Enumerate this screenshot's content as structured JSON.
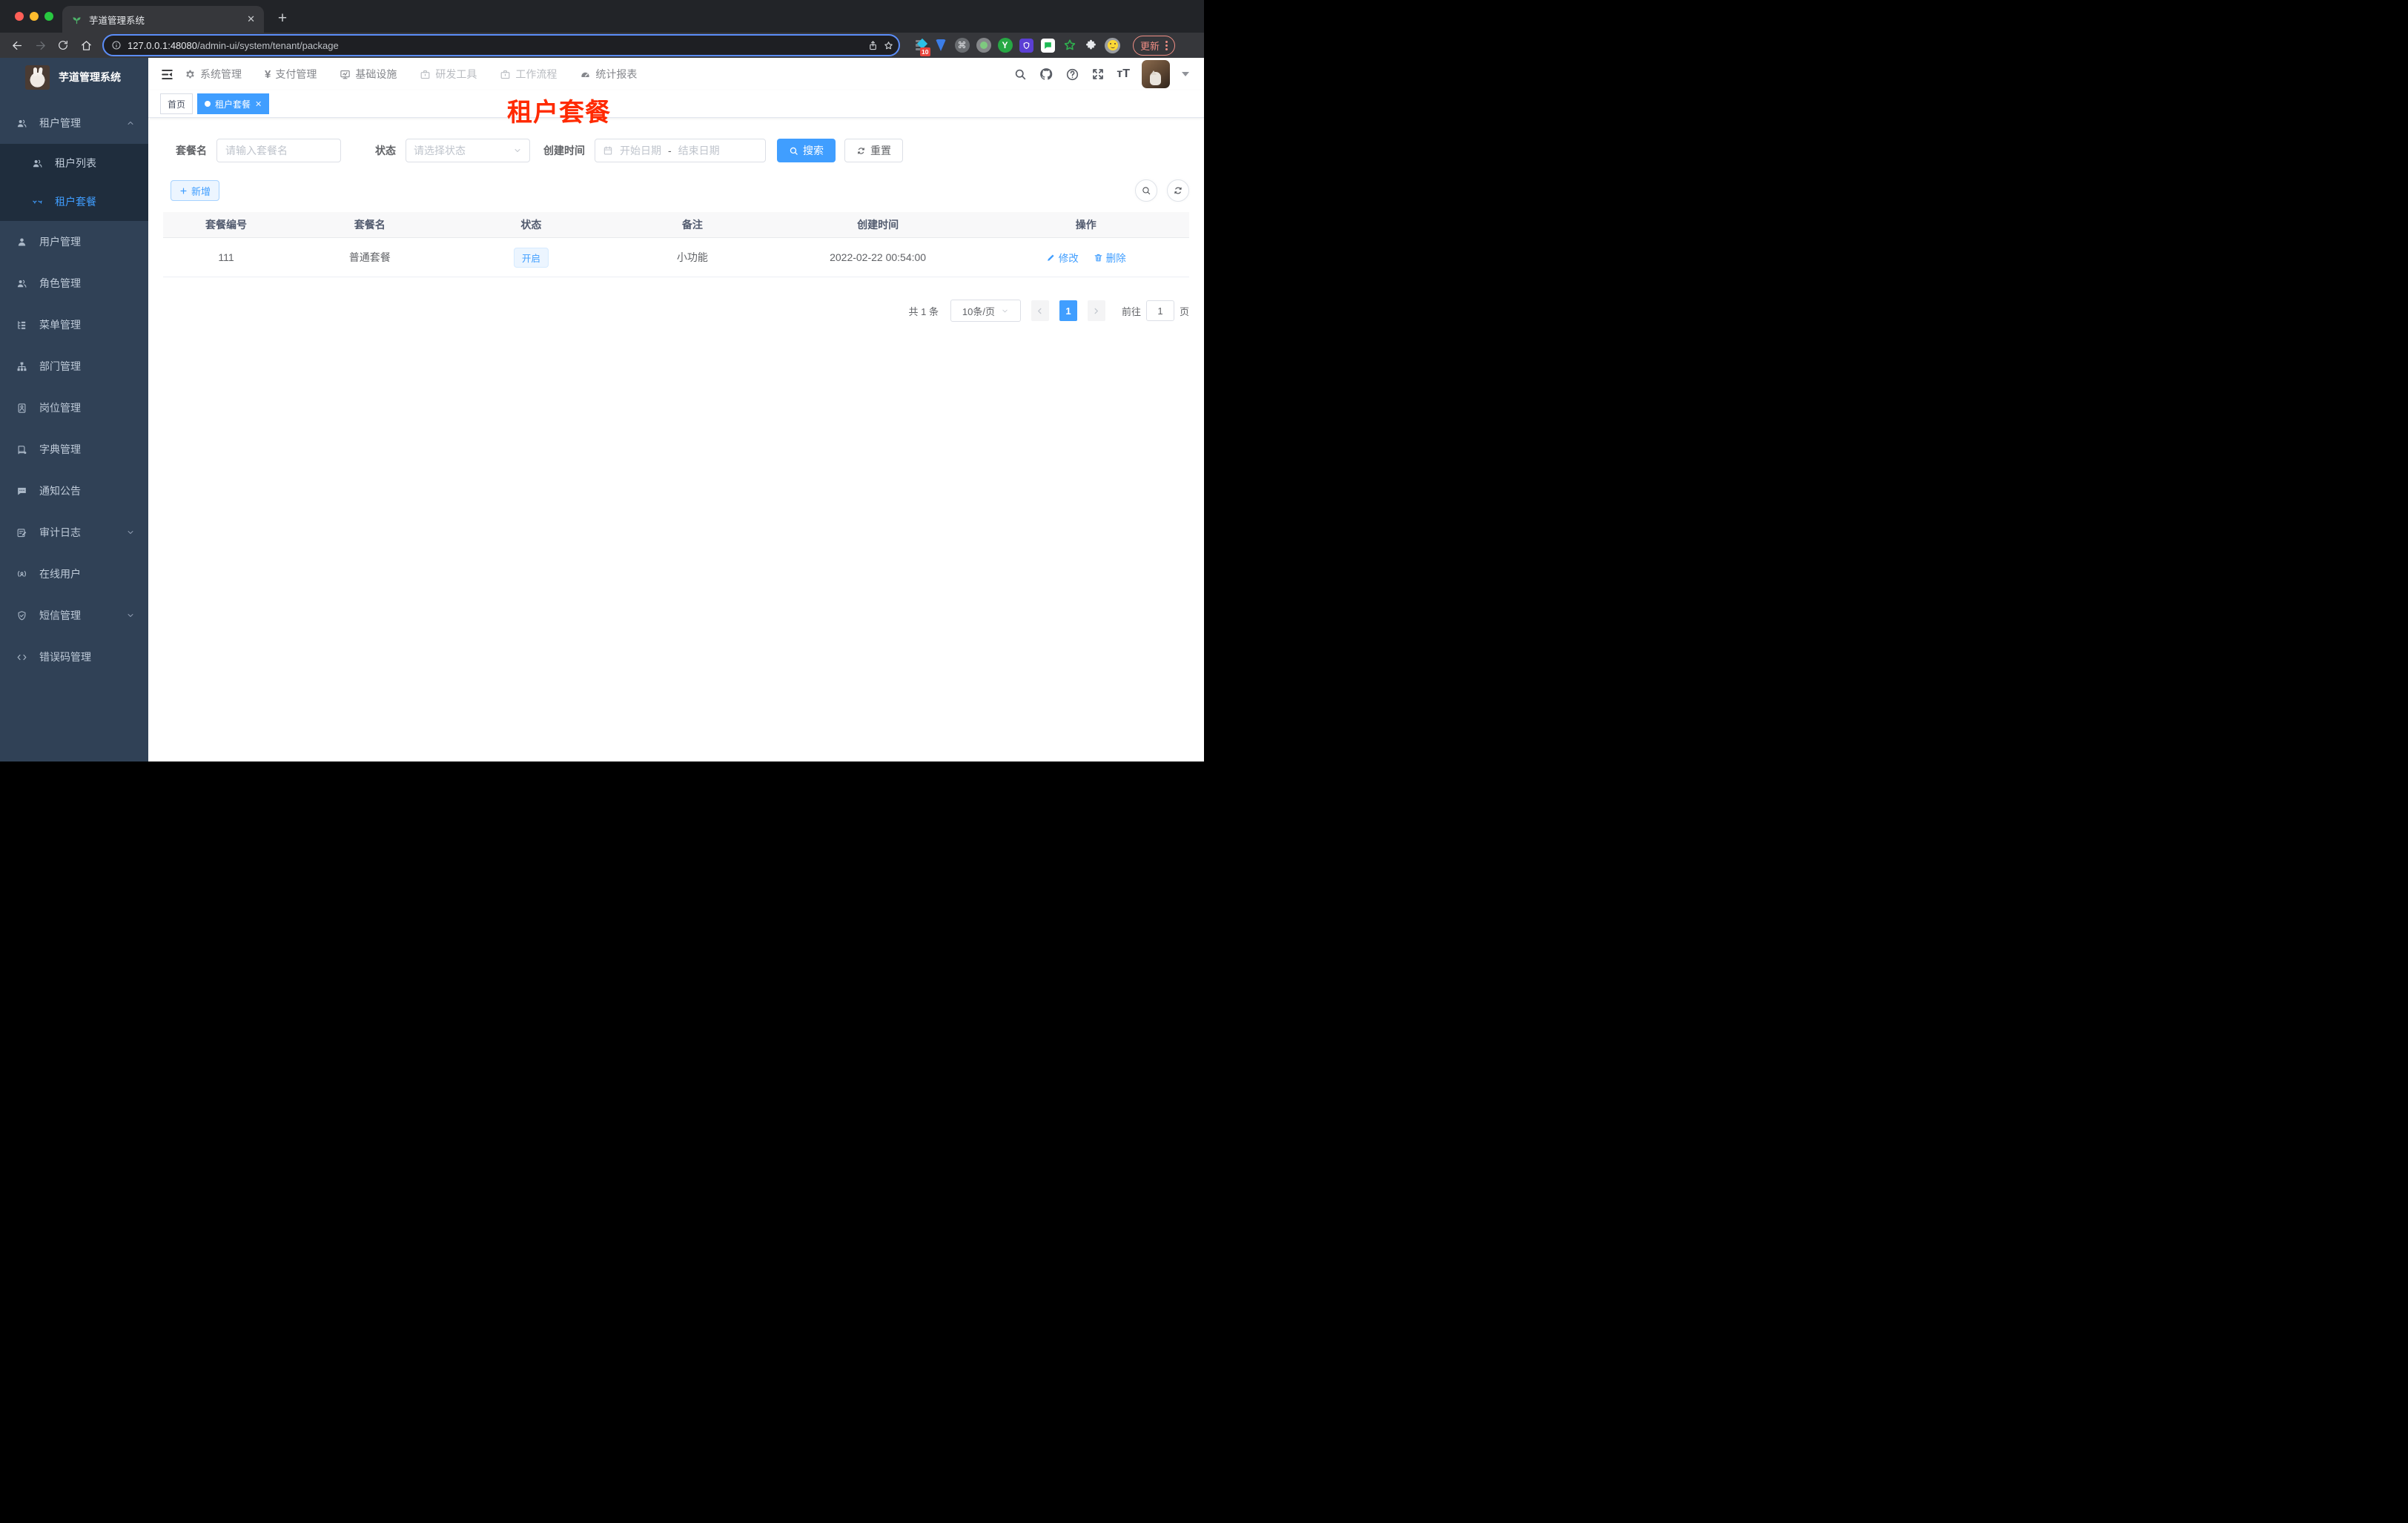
{
  "browser": {
    "tab_title": "芋道管理系统",
    "url_host": "127.0.0.1:48080",
    "url_path": "/admin-ui/system/tenant/package",
    "extension_badge": "10",
    "extension_y_label": "Y",
    "update_label": "更新",
    "new_tab_label": "+",
    "close_tab_label": "✕"
  },
  "sidebar": {
    "title": "芋道管理系统",
    "items": [
      {
        "label": "租户管理"
      },
      {
        "label": "租户列表"
      },
      {
        "label": "租户套餐"
      },
      {
        "label": "用户管理"
      },
      {
        "label": "角色管理"
      },
      {
        "label": "菜单管理"
      },
      {
        "label": "部门管理"
      },
      {
        "label": "岗位管理"
      },
      {
        "label": "字典管理"
      },
      {
        "label": "通知公告"
      },
      {
        "label": "审计日志"
      },
      {
        "label": "在线用户"
      },
      {
        "label": "短信管理"
      },
      {
        "label": "错误码管理"
      }
    ]
  },
  "top_nav": {
    "menus": [
      {
        "label": "系统管理"
      },
      {
        "label": "支付管理"
      },
      {
        "label": "基础设施"
      },
      {
        "label": "研发工具"
      },
      {
        "label": "工作流程"
      },
      {
        "label": "统计报表"
      }
    ]
  },
  "tags": {
    "home": "首页",
    "active": "租户套餐",
    "close": "✕"
  },
  "annotation": {
    "text": "租户套餐"
  },
  "filter": {
    "name_label": "套餐名",
    "name_placeholder": "请输入套餐名",
    "status_label": "状态",
    "status_placeholder": "请选择状态",
    "time_label": "创建时间",
    "start_placeholder": "开始日期",
    "separator": "-",
    "end_placeholder": "结束日期",
    "search_label": "搜索",
    "reset_label": "重置"
  },
  "toolbar": {
    "add_label": "新增"
  },
  "table": {
    "headers": [
      "套餐编号",
      "套餐名",
      "状态",
      "备注",
      "创建时间",
      "操作"
    ],
    "rows": [
      {
        "id": "111",
        "name": "普通套餐",
        "status": "开启",
        "remark": "小功能",
        "created": "2022-02-22 00:54:00",
        "edit": "修改",
        "delete": "删除"
      }
    ]
  },
  "pagination": {
    "total": "共 1 条",
    "page_size": "10条/页",
    "page": "1",
    "goto_label": "前往",
    "goto_value": "1",
    "unit": "页"
  },
  "colors": {
    "primary": "#409eff",
    "sidebar_bg": "#304156",
    "submenu_bg": "#1f2d3d",
    "annotation_red": "#ff2a00",
    "status_tag_bg": "#ecf5ff"
  }
}
